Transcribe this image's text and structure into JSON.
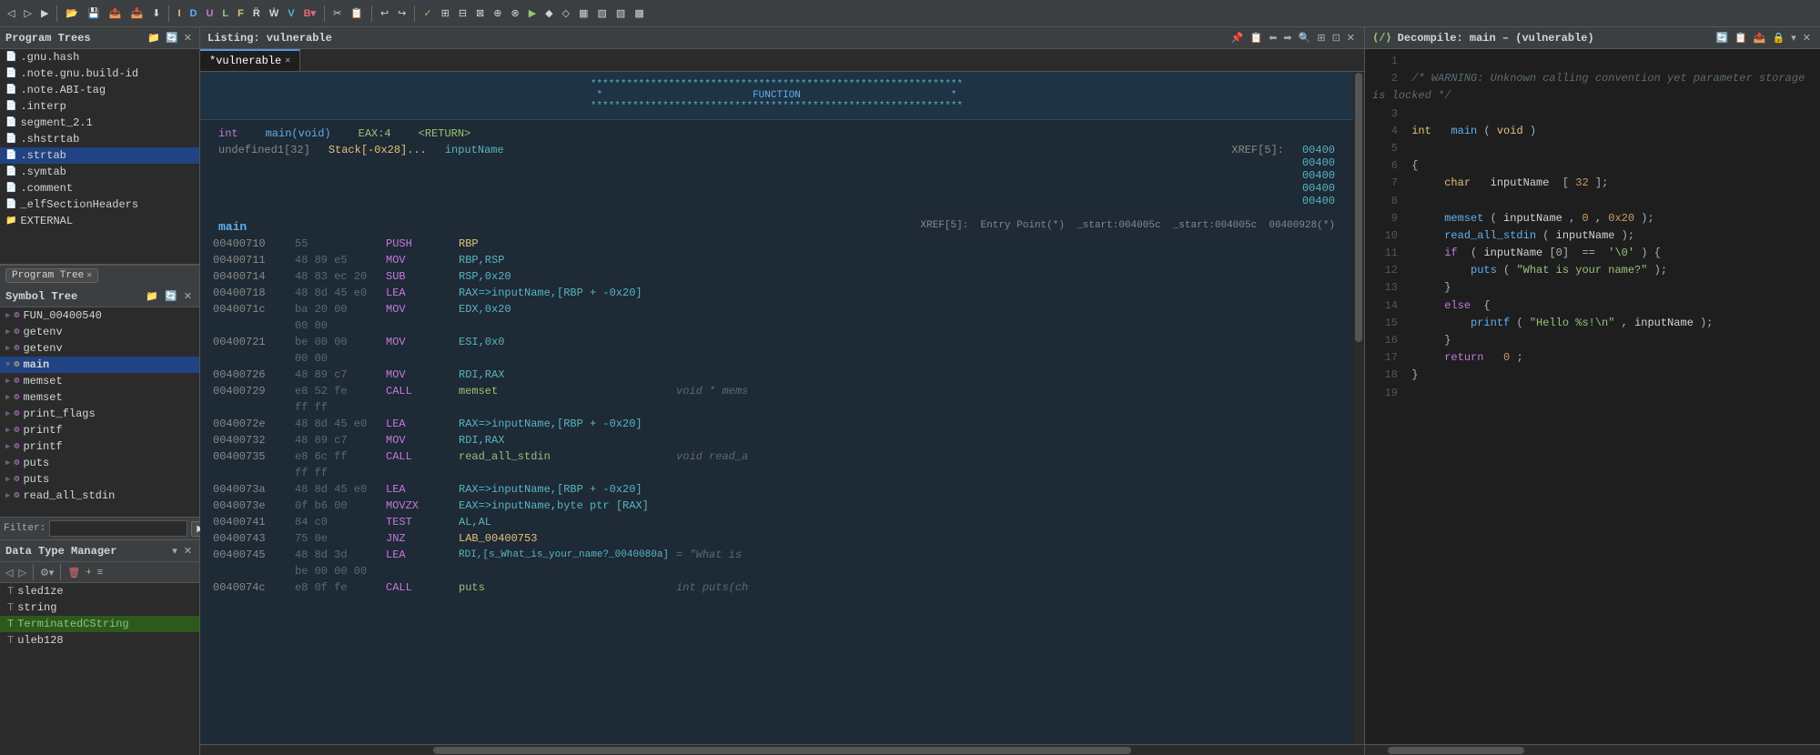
{
  "toolbar": {
    "buttons": [
      "◁",
      "▷",
      "▶",
      "▸",
      "▹",
      "◈",
      "◉",
      "⊡",
      "◻",
      "◼",
      "⬛",
      "⊞",
      "⊟",
      "⊠",
      "⊕",
      "⊗",
      "⬡",
      "⬢",
      "⬣",
      "◆",
      "◇",
      "▦",
      "▧",
      "▨",
      "▩",
      "▪",
      "▫",
      "▬",
      "▭",
      "▮",
      "▯"
    ]
  },
  "program_trees": {
    "title": "Program Trees",
    "items": [
      {
        "name": ".gnu.hash",
        "type": "file"
      },
      {
        "name": ".note.gnu.build-id",
        "type": "file"
      },
      {
        "name": ".note.ABI-tag",
        "type": "file"
      },
      {
        "name": ".interp",
        "type": "file"
      },
      {
        "name": "segment_2.1",
        "type": "file"
      },
      {
        "name": ".shstrtab",
        "type": "file"
      },
      {
        "name": ".strtab",
        "type": "file",
        "selected": true
      },
      {
        "name": ".symtab",
        "type": "file"
      },
      {
        "name": ".comment",
        "type": "file"
      },
      {
        "name": "_elfSectionHeaders",
        "type": "file"
      },
      {
        "name": "EXTERNAL",
        "type": "folder"
      }
    ],
    "tab_label": "Program Tree"
  },
  "symbol_tree": {
    "title": "Symbol Tree",
    "items": [
      {
        "name": "FUN_00400540",
        "type": "func"
      },
      {
        "name": "getenv",
        "type": "func"
      },
      {
        "name": "getenv",
        "type": "func"
      },
      {
        "name": "main",
        "type": "func",
        "selected": true
      },
      {
        "name": "memset",
        "type": "func"
      },
      {
        "name": "memset",
        "type": "func"
      },
      {
        "name": "print_flags",
        "type": "func"
      },
      {
        "name": "printf",
        "type": "func"
      },
      {
        "name": "printf",
        "type": "func"
      },
      {
        "name": "puts",
        "type": "func"
      },
      {
        "name": "puts",
        "type": "func"
      },
      {
        "name": "read_all_stdin",
        "type": "func"
      }
    ],
    "filter_placeholder": "Filter:"
  },
  "data_type_manager": {
    "title": "Data Type Manager",
    "items": [
      {
        "name": "sled1ze",
        "type": "dt"
      },
      {
        "name": "string",
        "type": "dt"
      },
      {
        "name": "TerminatedCString",
        "type": "dt",
        "highlighted": true
      },
      {
        "name": "uleb128",
        "type": "dt"
      }
    ]
  },
  "listing": {
    "title": "Listing:  vulnerable",
    "tab_label": "*vulnerable",
    "header_stars": "**************************************************************",
    "header_function": "FUNCTION",
    "header_stars2": "**************************************************************",
    "function_sig": {
      "type_label": "int",
      "name_label": "main(void)",
      "eax_label": "EAX:4",
      "return_label": "<RETURN>",
      "stack_label": "undefined1[32]",
      "stack_addr": "Stack[-0x28]...",
      "var_name": "inputName",
      "xref_label": "XREF[5]:",
      "addrs": [
        "00400",
        "00400",
        "00400",
        "00400",
        "00400"
      ]
    },
    "main_label": "main",
    "main_xref": "XREF[5]:",
    "main_entry": "Entry Point(*)",
    "main_start1": "_start:004005c",
    "main_start2": "_start:004005c",
    "main_addr": "00400928(*)",
    "asm_rows": [
      {
        "addr": "00400710",
        "bytes": "55",
        "mnem": "PUSH",
        "op1": "RBP",
        "op2": "",
        "comment": ""
      },
      {
        "addr": "00400711",
        "bytes": "48 89 e5",
        "mnem": "MOV",
        "op1": "RBP,RSP",
        "op2": "",
        "comment": ""
      },
      {
        "addr": "00400714",
        "bytes": "48 83 ec 20",
        "mnem": "SUB",
        "op1": "RSP,0x20",
        "op2": "",
        "comment": ""
      },
      {
        "addr": "00400718",
        "bytes": "48 8d 45 e0",
        "mnem": "LEA",
        "op1": "RAX=>inputName,[RBP + -0x20]",
        "op2": "",
        "comment": ""
      },
      {
        "addr": "0040071c",
        "bytes": "ba 20 00",
        "mnem": "MOV",
        "op1": "EDX,0x20",
        "op2": "",
        "comment": ""
      },
      {
        "addr": "",
        "bytes": "00 00",
        "mnem": "",
        "op1": "",
        "op2": "",
        "comment": ""
      },
      {
        "addr": "00400721",
        "bytes": "be 00 00",
        "mnem": "MOV",
        "op1": "ESI,0x0",
        "op2": "",
        "comment": ""
      },
      {
        "addr": "",
        "bytes": "00 00",
        "mnem": "",
        "op1": "",
        "op2": "",
        "comment": ""
      },
      {
        "addr": "00400726",
        "bytes": "48 89 c7",
        "mnem": "MOV",
        "op1": "RDI,RAX",
        "op2": "",
        "comment": ""
      },
      {
        "addr": "00400729",
        "bytes": "e8 52 fe",
        "mnem": "CALL",
        "op1": "memset",
        "op2": "",
        "comment": "void * mems"
      },
      {
        "addr": "",
        "bytes": "ff ff",
        "mnem": "",
        "op1": "",
        "op2": "",
        "comment": ""
      },
      {
        "addr": "0040072e",
        "bytes": "48 8d 45 e0",
        "mnem": "LEA",
        "op1": "RAX=>inputName,[RBP + -0x20]",
        "op2": "",
        "comment": ""
      },
      {
        "addr": "00400732",
        "bytes": "48 89 c7",
        "mnem": "MOV",
        "op1": "RDI,RAX",
        "op2": "",
        "comment": ""
      },
      {
        "addr": "00400735",
        "bytes": "e8 6c ff",
        "mnem": "CALL",
        "op1": "read_all_stdin",
        "op2": "",
        "comment": "void read_a"
      },
      {
        "addr": "",
        "bytes": "ff ff",
        "mnem": "",
        "op1": "",
        "op2": "",
        "comment": ""
      },
      {
        "addr": "0040073a",
        "bytes": "48 8d 45 e0",
        "mnem": "LEA",
        "op1": "RAX=>inputName,[RBP + -0x20]",
        "op2": "",
        "comment": ""
      },
      {
        "addr": "0040073e",
        "bytes": "0f b6 00",
        "mnem": "MOVZX",
        "op1": "EAX=>inputName,byte ptr [RAX]",
        "op2": "",
        "comment": ""
      },
      {
        "addr": "00400741",
        "bytes": "84 c0",
        "mnem": "TEST",
        "op1": "AL,AL",
        "op2": "",
        "comment": ""
      },
      {
        "addr": "00400743",
        "bytes": "75 0e",
        "mnem": "JNZ",
        "op1": "LAB_00400753",
        "op2": "",
        "comment": ""
      },
      {
        "addr": "00400745",
        "bytes": "48 8d 3d",
        "mnem": "LEA",
        "op1": "RDI,[s_What_is_your_name?_0040080a]",
        "op2": "",
        "comment": "= \"What is"
      },
      {
        "addr": "",
        "bytes": "be 00 00 00",
        "mnem": "",
        "op1": "",
        "op2": "",
        "comment": ""
      },
      {
        "addr": "0040074c",
        "bytes": "e8 0f fe",
        "mnem": "CALL",
        "op1": "puts",
        "op2": "",
        "comment": "int puts(ch"
      }
    ]
  },
  "decompiler": {
    "title": "Decompile: main – (vulnerable)",
    "lines": [
      {
        "num": "1",
        "content": ""
      },
      {
        "num": "2",
        "content": "/* WARNING: Unknown calling convention yet parameter storage is locked */",
        "type": "comment"
      },
      {
        "num": "3",
        "content": ""
      },
      {
        "num": "4",
        "content": "int main(void)",
        "type": "sig"
      },
      {
        "num": "5",
        "content": ""
      },
      {
        "num": "6",
        "content": "{",
        "type": "brace"
      },
      {
        "num": "7",
        "content": "    char inputName [32];",
        "type": "decl"
      },
      {
        "num": "8",
        "content": ""
      },
      {
        "num": "9",
        "content": "    memset(inputName,0,0x20);",
        "type": "stmt"
      },
      {
        "num": "10",
        "content": "    read_all_stdin(inputName);",
        "type": "stmt"
      },
      {
        "num": "11",
        "content": "    if (inputName[0] == '\\0') {",
        "type": "stmt"
      },
      {
        "num": "12",
        "content": "        puts(\"What is your name?\");",
        "type": "stmt"
      },
      {
        "num": "13",
        "content": "    }",
        "type": "brace"
      },
      {
        "num": "14",
        "content": "    else {",
        "type": "stmt"
      },
      {
        "num": "15",
        "content": "        printf(\"Hello %s!\\n\",inputName);",
        "type": "stmt"
      },
      {
        "num": "16",
        "content": "    }",
        "type": "brace"
      },
      {
        "num": "17",
        "content": "    return 0;",
        "type": "stmt"
      },
      {
        "num": "18",
        "content": "}",
        "type": "brace"
      },
      {
        "num": "19",
        "content": ""
      }
    ]
  }
}
